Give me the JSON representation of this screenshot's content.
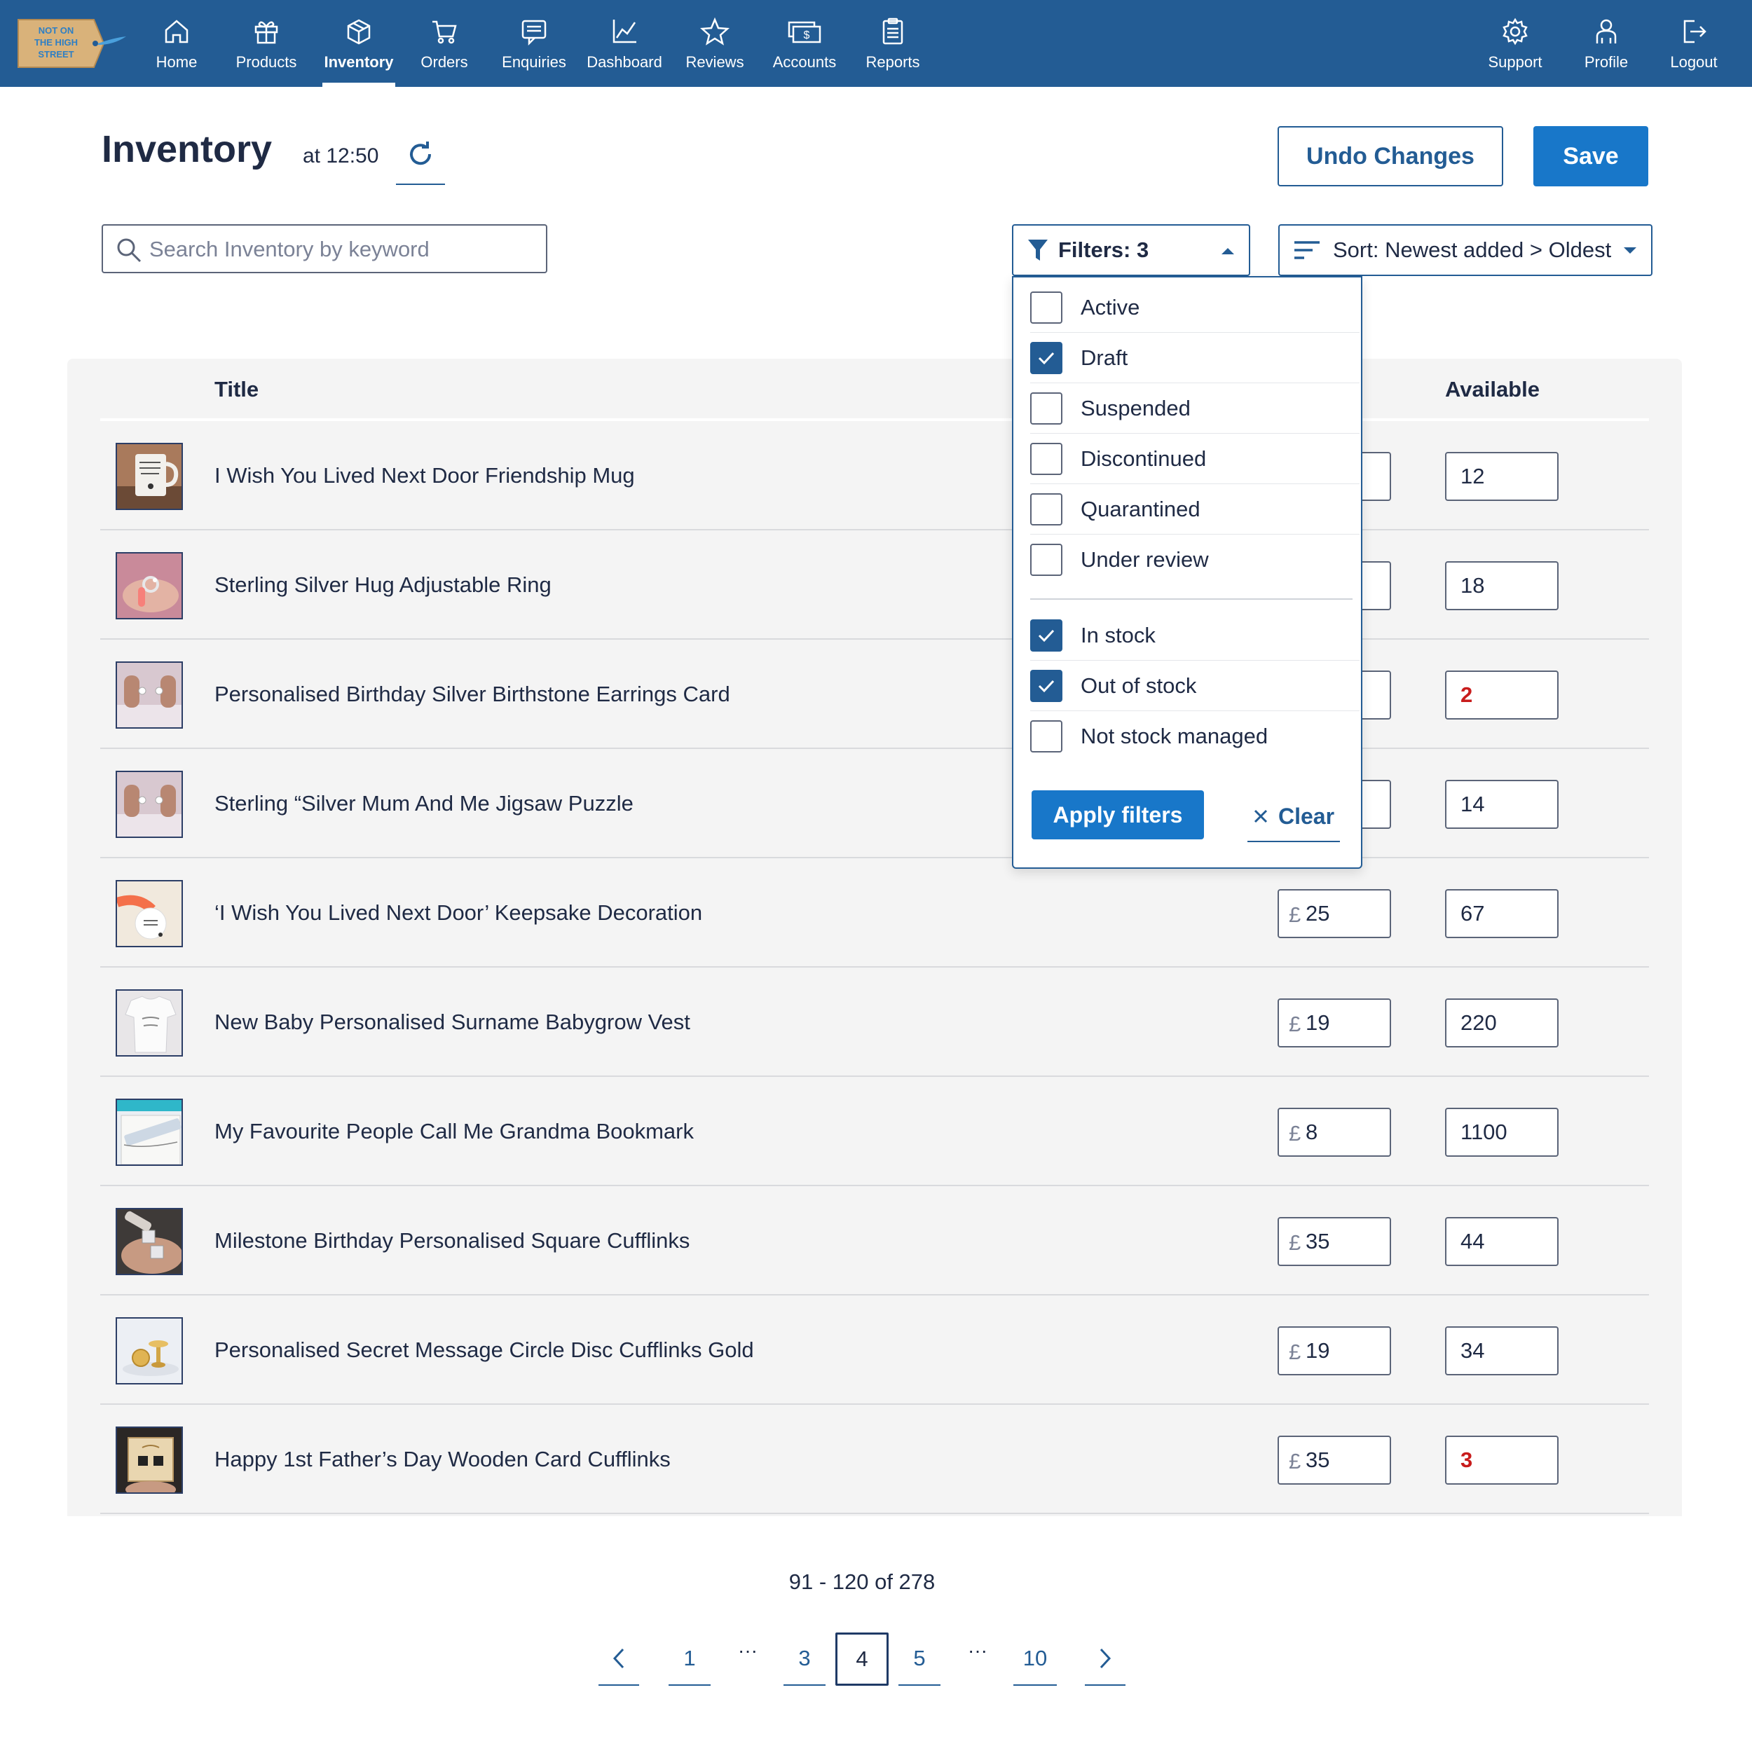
{
  "nav": {
    "brand_text": [
      "NOT ON",
      "THE HIGH",
      "STREET"
    ],
    "items": [
      {
        "label": "Home",
        "icon": "home-icon"
      },
      {
        "label": "Products",
        "icon": "gift-icon"
      },
      {
        "label": "Inventory",
        "icon": "box-icon",
        "active": true
      },
      {
        "label": "Orders",
        "icon": "cart-icon"
      },
      {
        "label": "Enquiries",
        "icon": "message-icon"
      },
      {
        "label": "Dashboard",
        "icon": "chart-icon"
      },
      {
        "label": "Reviews",
        "icon": "star-icon"
      },
      {
        "label": "Accounts",
        "icon": "money-icon"
      },
      {
        "label": "Reports",
        "icon": "clipboard-icon"
      }
    ],
    "right_items": [
      {
        "label": "Support",
        "icon": "gear-icon"
      },
      {
        "label": "Profile",
        "icon": "user-icon"
      },
      {
        "label": "Logout",
        "icon": "logout-icon"
      }
    ]
  },
  "header": {
    "title": "Inventory",
    "time": "at 12:50",
    "undo_label": "Undo Changes",
    "save_label": "Save"
  },
  "search": {
    "placeholder": "Search Inventory by keyword",
    "value": ""
  },
  "filters": {
    "label": "Filters: 3",
    "status_options": [
      {
        "label": "Active",
        "checked": false
      },
      {
        "label": "Draft",
        "checked": true
      },
      {
        "label": "Suspended",
        "checked": false
      },
      {
        "label": "Discontinued",
        "checked": false
      },
      {
        "label": "Quarantined",
        "checked": false
      },
      {
        "label": "Under review",
        "checked": false
      }
    ],
    "stock_options": [
      {
        "label": "In stock",
        "checked": true
      },
      {
        "label": "Out of stock",
        "checked": true
      },
      {
        "label": "Not stock managed",
        "checked": false
      }
    ],
    "apply_label": "Apply filters",
    "clear_label": "Clear"
  },
  "sort": {
    "label": "Sort: Newest added > Oldest"
  },
  "table": {
    "columns": {
      "title": "Title",
      "available": "Available"
    },
    "currency": "£",
    "rows": [
      {
        "title": "I Wish You Lived Next Door Friendship Mug",
        "price": "",
        "available": "12",
        "low": false
      },
      {
        "title": "Sterling Silver Hug Adjustable Ring",
        "price": "",
        "available": "18",
        "low": false
      },
      {
        "title": "Personalised Birthday Silver Birthstone Earrings Card",
        "price": "",
        "available": "2",
        "low": true
      },
      {
        "title": "Sterling “Silver Mum And Me Jigsaw Puzzle",
        "price": "",
        "available": "14",
        "low": false
      },
      {
        "title": "‘I Wish You Lived Next Door’ Keepsake Decoration",
        "price": "25",
        "available": "67",
        "low": false
      },
      {
        "title": "New Baby Personalised Surname Babygrow Vest",
        "price": "19",
        "available": "220",
        "low": false
      },
      {
        "title": "My Favourite People Call Me Grandma Bookmark",
        "price": "8",
        "available": "1100",
        "low": false
      },
      {
        "title": "Milestone Birthday Personalised Square Cufflinks",
        "price": "35",
        "available": "44",
        "low": false
      },
      {
        "title": "Personalised Secret Message Circle Disc Cufflinks Gold",
        "price": "19",
        "available": "34",
        "low": false
      },
      {
        "title": "Happy 1st Father’s Day Wooden Card Cufflinks",
        "price": "35",
        "available": "3",
        "low": true
      }
    ]
  },
  "pagination": {
    "range": "91 - 120 of 278",
    "pages": [
      "1",
      "3",
      "4",
      "5",
      "10"
    ],
    "current": "4",
    "ellipsis": "···"
  },
  "colors": {
    "brand": "#235c94",
    "accent": "#1877c9",
    "low_stock": "#c81c1c"
  }
}
